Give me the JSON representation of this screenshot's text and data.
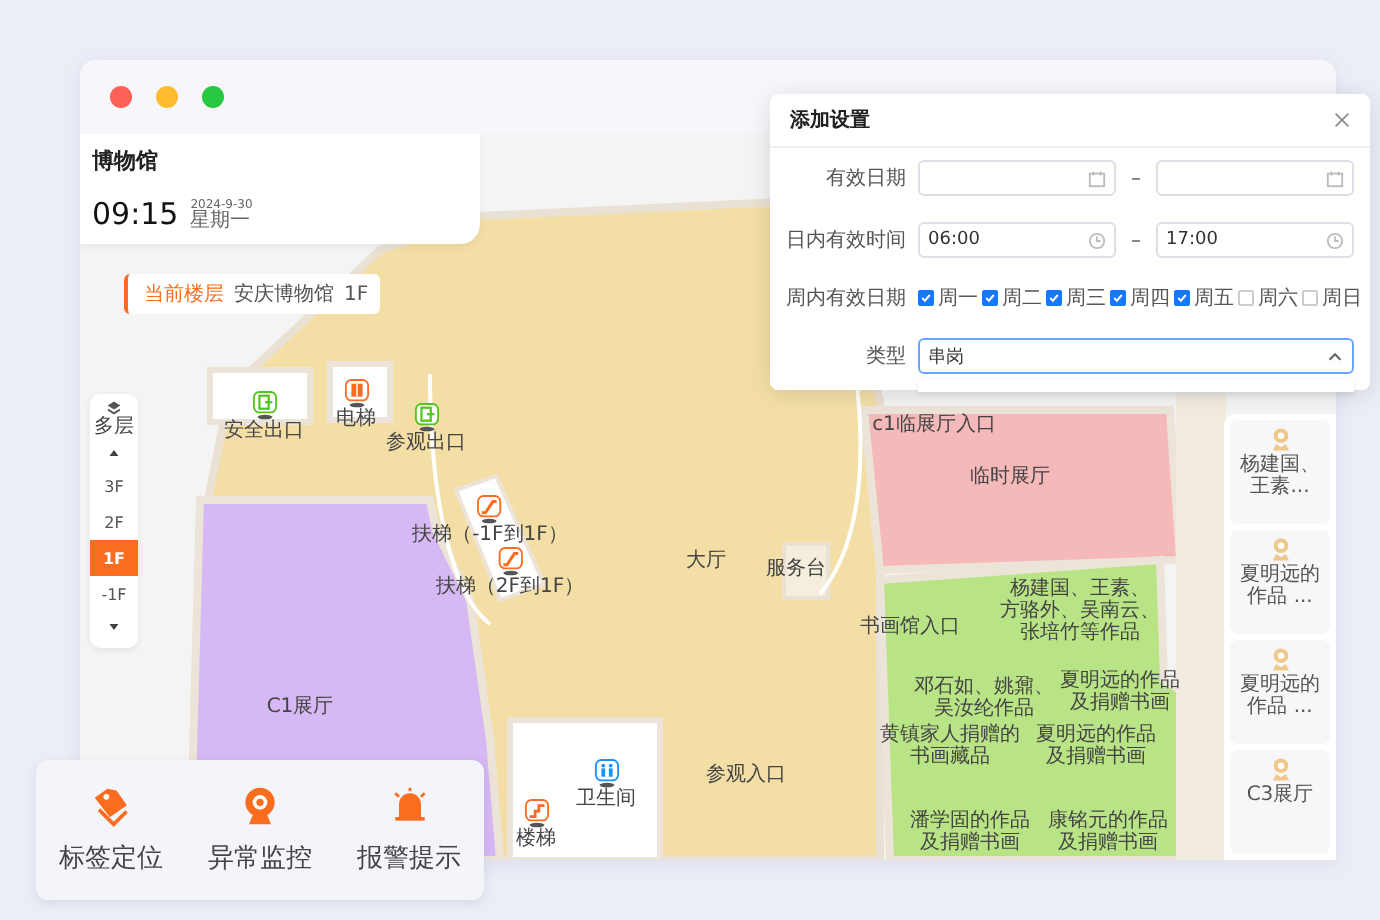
{
  "window": {
    "title": "博物馆"
  },
  "clock": {
    "time": "09:15",
    "date": "2024-9-30",
    "weekday": "星期一"
  },
  "current_floor": {
    "label": "当前楼层",
    "building": "安庆博物馆",
    "floor": "1F"
  },
  "floor_selector": {
    "label": "多层",
    "floors": [
      {
        "label": "3F",
        "selected": false
      },
      {
        "label": "2F",
        "selected": false
      },
      {
        "label": "1F",
        "selected": true
      },
      {
        "label": "-1F",
        "selected": false
      }
    ]
  },
  "map": {
    "points": [
      {
        "kind": "exit",
        "label": "安全出口"
      },
      {
        "kind": "elevator",
        "label": "电梯"
      },
      {
        "kind": "exit",
        "label": "参观出口"
      },
      {
        "kind": "escalator",
        "label": "扶梯（-1F到1F）"
      },
      {
        "kind": "escalator",
        "label": "扶梯（2F到1F）"
      },
      {
        "kind": "restroom",
        "label": "卫生间"
      },
      {
        "kind": "stairs",
        "label": "楼梯"
      }
    ],
    "areas": [
      {
        "lines": [
          "大厅"
        ]
      },
      {
        "lines": [
          "服务台"
        ]
      },
      {
        "lines": [
          "c1临展厅入口"
        ]
      },
      {
        "lines": [
          "临时展厅"
        ]
      },
      {
        "lines": [
          "书画馆入口"
        ]
      },
      {
        "lines": [
          "C1展厅"
        ]
      },
      {
        "lines": [
          "参观入口"
        ]
      },
      {
        "lines": [
          "杨建国、王素、",
          "方骆外、吴南云、",
          "张培竹等作品"
        ]
      },
      {
        "lines": [
          "邓石如、姚鼐、",
          "吴汝纶作品"
        ]
      },
      {
        "lines": [
          "夏明远的作品",
          "及捐赠书画"
        ]
      },
      {
        "lines": [
          "黄镇家人捐赠的",
          "书画藏品"
        ]
      },
      {
        "lines": [
          "夏明远的作品",
          "及捐赠书画"
        ]
      },
      {
        "lines": [
          "潘学固的作品",
          "及捐赠书画"
        ]
      },
      {
        "lines": [
          "康铭元的作品",
          "及捐赠书画"
        ]
      }
    ]
  },
  "sidebar": {
    "cards": [
      {
        "label": "杨建国、王素..."
      },
      {
        "label": "夏明远的作品 ..."
      },
      {
        "label": "夏明远的作品 ..."
      },
      {
        "label": "C3展厅"
      }
    ]
  },
  "dialog": {
    "title": "添加设置",
    "fields": [
      {
        "kind": "date_range",
        "label": "有效日期"
      },
      {
        "kind": "time_range",
        "label": "日内有效时间",
        "start": "06:00",
        "end": "17:00"
      },
      {
        "kind": "weekdays",
        "label": "周内有效日期",
        "days": [
          {
            "label": "周一",
            "checked": true
          },
          {
            "label": "周二",
            "checked": true
          },
          {
            "label": "周三",
            "checked": true
          },
          {
            "label": "周四",
            "checked": true
          },
          {
            "label": "周五",
            "checked": true
          },
          {
            "label": "周六",
            "checked": false
          },
          {
            "label": "周日",
            "checked": false
          }
        ]
      },
      {
        "kind": "select",
        "label": "类型",
        "value": "串岗",
        "expanded": true
      }
    ]
  },
  "features": [
    {
      "kind": "tag",
      "label": "标签定位"
    },
    {
      "kind": "camera",
      "label": "异常监控"
    },
    {
      "kind": "alarm",
      "label": "报警提示"
    }
  ]
}
